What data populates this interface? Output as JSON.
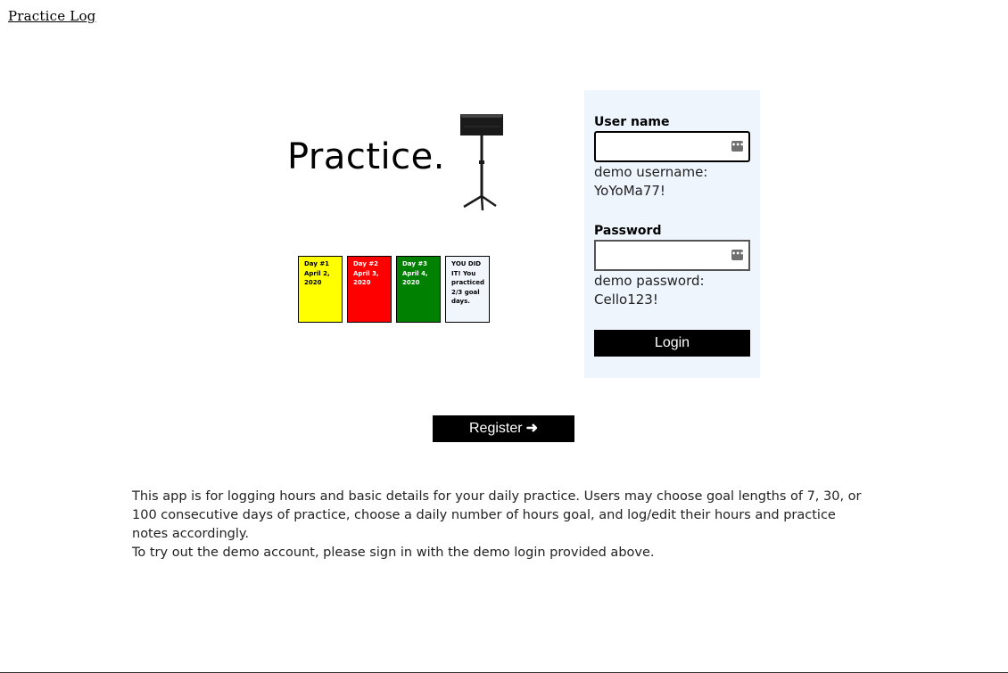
{
  "nav": {
    "title": "Practice Log"
  },
  "logo": {
    "wordmark": "Practice.",
    "icon": "music-stand-icon"
  },
  "cards": [
    {
      "text": "Day #1 April 2, 2020",
      "color": "#ffff00"
    },
    {
      "text": "Day #2 April 3, 2020",
      "color": "#ff0000"
    },
    {
      "text": "Day #3 April 4, 2020",
      "color": "#008000"
    },
    {
      "text": "YOU DID IT! You practiced 2/3 goal days.",
      "color": "#f1f6fd"
    }
  ],
  "login": {
    "username_label": "User name",
    "username_value": "",
    "username_hint": "demo username: YoYoMa77!",
    "password_label": "Password",
    "password_value": "",
    "password_hint": "demo password: Cello123!",
    "login_label": "Login",
    "field_icon": "password-manager-icon"
  },
  "register": {
    "label": "Register",
    "icon": "arrow-right-icon"
  },
  "description": {
    "paragraph1": "This app is for logging hours and basic details for your daily practice. Users may choose goal lengths of 7, 30, or 100 consecutive days of practice, choose a daily number of hours goal, and log/edit their hours and practice notes accordingly.",
    "paragraph2": "To try out the demo account, please sign in with the demo login provided above."
  },
  "colors": {
    "panel_bg": "#eef5fd",
    "button_bg": "#000000",
    "button_text": "#ffffff"
  }
}
